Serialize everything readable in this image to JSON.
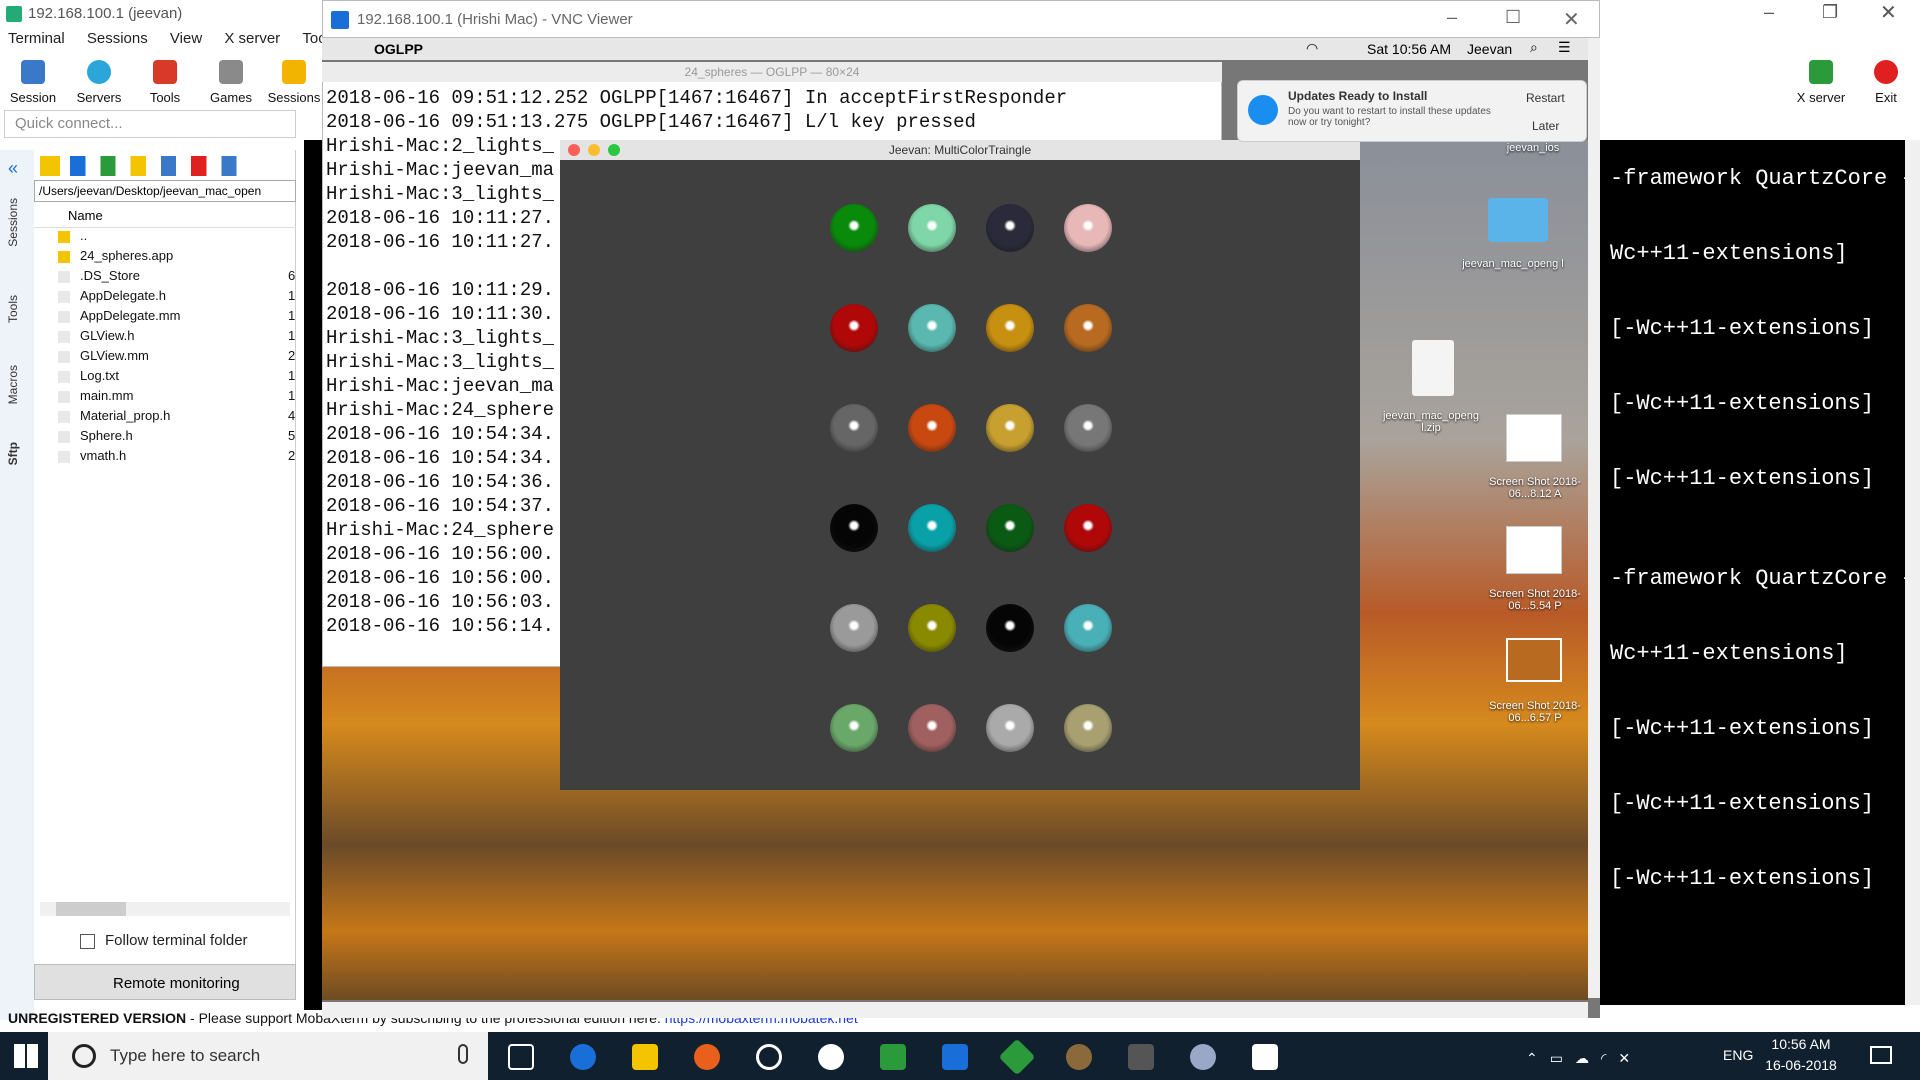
{
  "moba": {
    "title": "192.168.100.1 (jeevan)",
    "menu": [
      "Terminal",
      "Sessions",
      "View",
      "X server",
      "Tools"
    ],
    "toolbar": [
      "Session",
      "Servers",
      "Tools",
      "Games",
      "Sessions"
    ],
    "toolbar_right": [
      "X server",
      "Exit"
    ],
    "quick_connect": "Quick connect...",
    "side_tabs": [
      "Sessions",
      "Tools",
      "Macros",
      "Sftp"
    ],
    "sftp_path": "/Users/jeevan/Desktop/jeevan_mac_open",
    "file_header": "Name",
    "files": [
      "..",
      "24_spheres.app",
      ".DS_Store",
      "AppDelegate.h",
      "AppDelegate.mm",
      "GLView.h",
      "GLView.mm",
      "Log.txt",
      "main.mm",
      "Material_prop.h",
      "Sphere.h",
      "vmath.h"
    ],
    "file_sizes": [
      "",
      "",
      "6",
      "1",
      "1",
      "1",
      "2",
      "1",
      "1",
      "4",
      "5",
      "2"
    ],
    "follow_label": "Follow terminal folder",
    "remote_label": "Remote monitoring",
    "unregistered": "UNREGISTERED VERSION",
    "support_text": "-  Please support MobaXterm by subscribing to the professional edition here:",
    "support_link": "https://mobaxterm.mobatek.net",
    "right_terminal": [
      "-framework QuartzCore -",
      "Wc++11-extensions]",
      "[-Wc++11-extensions]",
      "[-Wc++11-extensions]",
      "[-Wc++11-extensions]",
      "-framework QuartzCore -",
      "Wc++11-extensions]",
      "[-Wc++11-extensions]",
      "[-Wc++11-extensions]",
      "[-Wc++11-extensions]"
    ]
  },
  "vnc": {
    "title": "192.168.100.1 (Hrishi Mac) - VNC Viewer",
    "mac_app": "OGLPP",
    "mac_clock": "Sat 10:56 AM",
    "mac_user": "Jeevan",
    "terminal_title": "24_spheres — OGLPP — 80×24",
    "terminal_lines": [
      "2018-06-16 09:51:12.252 OGLPP[1467:16467] In acceptFirstResponder",
      "2018-06-16 09:51:13.275 OGLPP[1467:16467] L/l key pressed",
      "Hrishi-Mac:2_lights_",
      "Hrishi-Mac:jeevan_ma",
      "Hrishi-Mac:3_lights_",
      "2018-06-16 10:11:27.",
      "2018-06-16 10:11:27.",
      "",
      "2018-06-16 10:11:29.",
      "2018-06-16 10:11:30.",
      "Hrishi-Mac:3_lights_",
      "Hrishi-Mac:3_lights_",
      "Hrishi-Mac:jeevan_ma",
      "Hrishi-Mac:24_sphere",
      "2018-06-16 10:54:34.",
      "2018-06-16 10:54:34.",
      "2018-06-16 10:54:36.",
      "2018-06-16 10:54:37.",
      "Hrishi-Mac:24_sphere",
      "2018-06-16 10:56:00.",
      "2018-06-16 10:56:00.",
      "2018-06-16 10:56:03.",
      "2018-06-16 10:56:14."
    ],
    "gl_title": "Jeevan: MultiColorTraingle",
    "notification": {
      "title": "Updates Ready to Install",
      "body": "Do you want to restart to install these updates now or try tonight?",
      "restart": "Restart",
      "later": "Later"
    },
    "desktop_icons": [
      "jeevan_ios",
      "jeevan_mac_openg l",
      "jeevan_mac_openg l.zip",
      "Screen Shot 2018-06...8.12 A",
      "Screen Shot 2018-06...5.54 P",
      "Screen Shot 2018-06...6.57 P"
    ],
    "sphere_colors": [
      "#0a8a0a",
      "#7fd6a8",
      "#2a2a3a",
      "#e8b8b8",
      "#b00808",
      "#5ab8b0",
      "#c89010",
      "#b86a20",
      "#666666",
      "#c84810",
      "#c8a030",
      "#777777",
      "#050505",
      "#0aa0a8",
      "#0a5a14",
      "#b00808",
      "#9a9a9a",
      "#8a8a00",
      "#050505",
      "#4ab0b8",
      "#6aa86a",
      "#a06060",
      "#aaaaaa",
      "#a8a070"
    ]
  },
  "taskbar": {
    "search": "Type here to search",
    "lang": "ENG",
    "time": "10:56 AM",
    "date": "16-06-2018"
  }
}
